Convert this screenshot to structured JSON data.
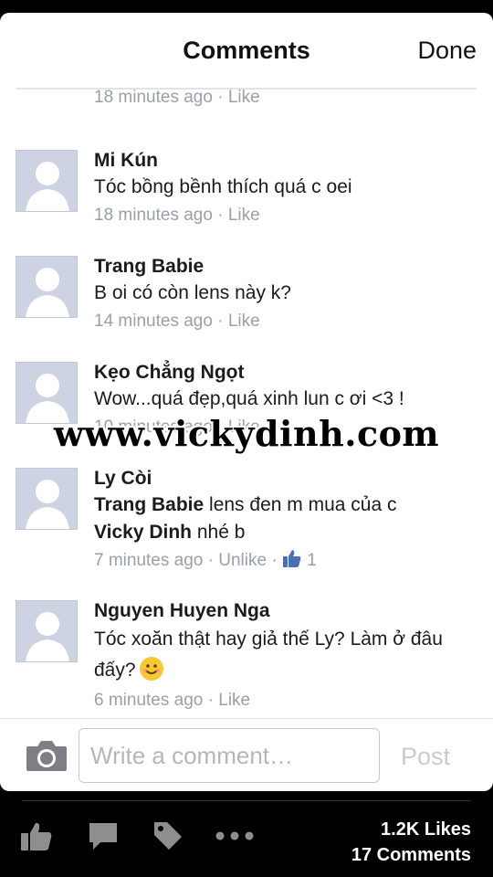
{
  "header": {
    "title": "Comments",
    "done_label": "Done"
  },
  "partial_meta": {
    "time": "18 minutes ago",
    "sep": " · ",
    "like": "Like"
  },
  "comments": [
    {
      "name": "Mi Kún",
      "text": "Tóc bồng bềnh thích quá c oei",
      "time": "18 minutes ago",
      "sep": " · ",
      "like": "Like"
    },
    {
      "name": "Trang Babie",
      "text": "B oi có còn lens này k?",
      "time": "14 minutes ago",
      "sep": " · ",
      "like": "Like"
    },
    {
      "name": "Kẹo Chẳng Ngọt",
      "text": "Wow...quá đẹp,quá xinh lun c ơi <3 !",
      "time": "10 minutes ago",
      "sep": " · ",
      "like": "Like"
    },
    {
      "name": "Ly Còi",
      "mention1": "Trang Babie",
      "text_part1": " lens đen m mua của c",
      "mention2": "Vicky Dinh",
      "text_part2": " nhé b",
      "time": "7 minutes ago",
      "sep": " · ",
      "like": "Unlike",
      "sep2": " · ",
      "like_count": "1"
    },
    {
      "name": "Nguyen Huyen Nga",
      "text": "Tóc xoăn thật hay giả thế Ly? Làm ở đâu đấy?",
      "emoji": "smiling-face",
      "time": "6 minutes ago",
      "sep": " · ",
      "like": "Like"
    }
  ],
  "watermark": "www.vickydinh.com",
  "composer": {
    "placeholder": "Write a comment…",
    "post_label": "Post"
  },
  "bottom_bar": {
    "icons": [
      "like-icon",
      "comment-icon",
      "tag-icon",
      "more-icon"
    ],
    "likes": "1.2K Likes",
    "comments": "17 Comments"
  },
  "colors": {
    "meta_gray": "#9aa0a8",
    "like_blue": "#4a6fb5",
    "avatar_bg": "#cdd3e3",
    "post_disabled": "#c8cbd0"
  }
}
